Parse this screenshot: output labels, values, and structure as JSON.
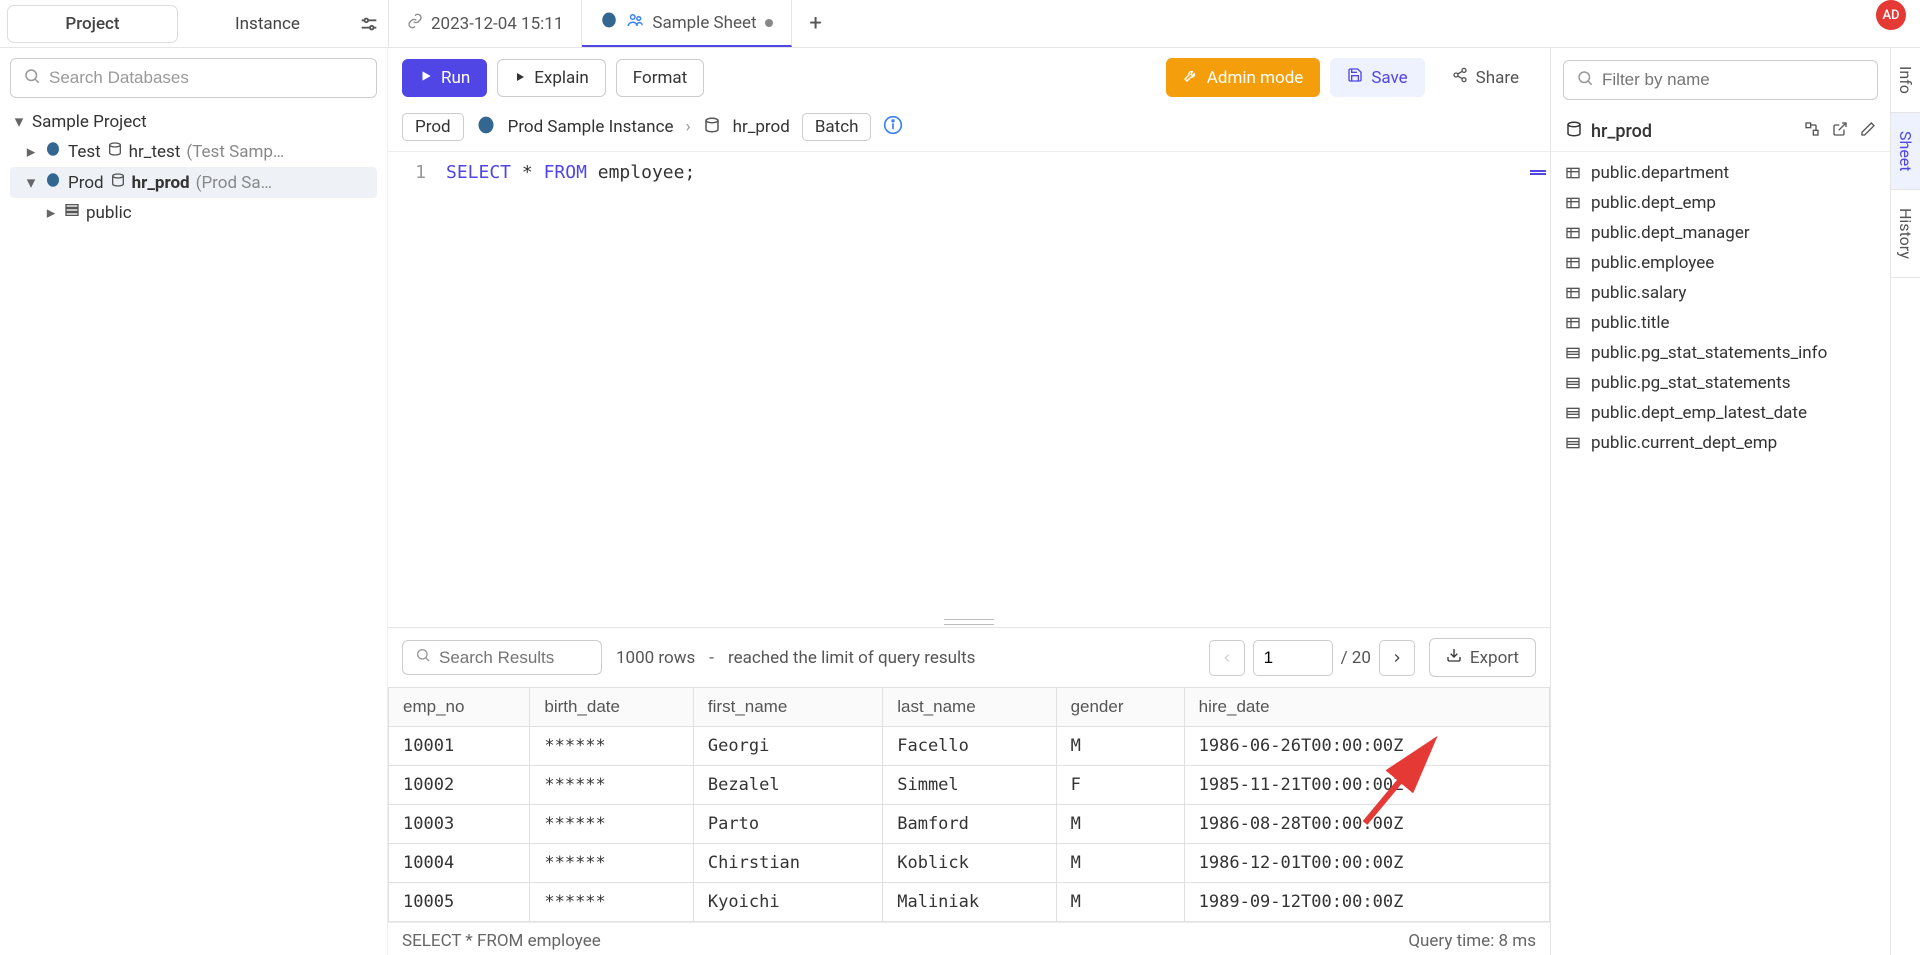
{
  "avatar": "AD",
  "left_tabs": {
    "project": "Project",
    "instance": "Instance"
  },
  "doc_tabs": [
    {
      "label": "2023-12-04 15:11",
      "active": false,
      "shared": false
    },
    {
      "label": "Sample Sheet",
      "active": true,
      "shared": true
    }
  ],
  "sidebar": {
    "search_placeholder": "Search Databases",
    "root": "Sample Project",
    "nodes": [
      {
        "env": "Test",
        "db": "hr_test",
        "extra": "(Test Samp…",
        "expanded": false,
        "selected": false
      },
      {
        "env": "Prod",
        "db": "hr_prod",
        "extra": "(Prod Sa…",
        "expanded": true,
        "selected": true
      }
    ],
    "schema": "public"
  },
  "toolbar": {
    "run": "Run",
    "explain": "Explain",
    "format": "Format",
    "admin": "Admin mode",
    "save": "Save",
    "share": "Share"
  },
  "crumbs": {
    "env_chip": "Prod",
    "instance": "Prod Sample Instance",
    "db": "hr_prod",
    "batch": "Batch"
  },
  "editor": {
    "line_no": "1",
    "kw1": "SELECT",
    "op": "*",
    "kw2": "FROM",
    "rest": " employee;"
  },
  "results": {
    "search_placeholder": "Search Results",
    "summary_rows": "1000 rows",
    "summary_sep": "-",
    "summary_msg": "reached the limit of query results",
    "page_current": "1",
    "page_total": "/ 20",
    "export": "Export",
    "columns": [
      "emp_no",
      "birth_date",
      "first_name",
      "last_name",
      "gender",
      "hire_date"
    ],
    "rows": [
      [
        "10001",
        "******",
        "Georgi",
        "Facello",
        "M",
        "1986-06-26T00:00:00Z"
      ],
      [
        "10002",
        "******",
        "Bezalel",
        "Simmel",
        "F",
        "1985-11-21T00:00:00Z"
      ],
      [
        "10003",
        "******",
        "Parto",
        "Bamford",
        "M",
        "1986-08-28T00:00:00Z"
      ],
      [
        "10004",
        "******",
        "Chirstian",
        "Koblick",
        "M",
        "1986-12-01T00:00:00Z"
      ],
      [
        "10005",
        "******",
        "Kyoichi",
        "Maliniak",
        "M",
        "1989-09-12T00:00:00Z"
      ]
    ]
  },
  "status": {
    "query": "SELECT * FROM employee",
    "time": "Query time: 8 ms"
  },
  "right": {
    "filter_placeholder": "Filter by name",
    "db": "hr_prod",
    "tables": [
      "public.department",
      "public.dept_emp",
      "public.dept_manager",
      "public.employee",
      "public.salary",
      "public.title"
    ],
    "views": [
      "public.pg_stat_statements_info",
      "public.pg_stat_statements",
      "public.dept_emp_latest_date",
      "public.current_dept_emp"
    ],
    "side_tabs": [
      "Info",
      "Sheet",
      "History"
    ]
  }
}
